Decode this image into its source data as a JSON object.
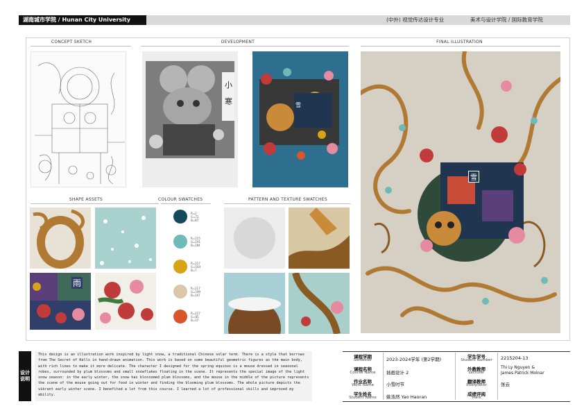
{
  "header": {
    "school": "湖南城市学院 / Hunan City University",
    "major": "(中外) 视觉传达设计专业",
    "college": "美术与设计学院 / 国际教育学院"
  },
  "sections": {
    "concept_sketch": "CONCEPT SKETCH",
    "development": "DEVELOPMENT",
    "final_illustration": "FINAL ILLUSTRATION",
    "shape_assets": "SHAPE ASSETS",
    "colour_swatches": "COLOUR SWATCHES",
    "pattern_swatches": "PATTERN AND TEXTURE SWATCHES"
  },
  "artwork": {
    "grey_glyph_1": "小",
    "grey_glyph_2": "寒",
    "blue_sign": "雪",
    "final_sign": "雪",
    "asset_glyph": "雨"
  },
  "swatches": [
    {
      "color": "#134b5d",
      "code": "R=2\nG=72\nB=87"
    },
    {
      "color": "#6fbab8",
      "code": "R=115\nG=191\nB=184"
    },
    {
      "color": "#d9a317",
      "code": "R=217\nG=164\nB=7"
    },
    {
      "color": "#d9c7a7",
      "code": "R=217\nG=199\nB=167"
    },
    {
      "color": "#d9552b",
      "code": "R=217\nG=85\nB=37"
    }
  ],
  "description": {
    "tag": "设计说明",
    "text": "This design is an illustration work inspired by light snow, a traditional Chinese solar term. There is a style that borrows from The Secret of Kells in hand-drawn animation. This work is based on some beautiful geometric figures as the main body, with rich lines to make it more delicate. The character I designed for the spring equinox is a mouse dressed in seasonal robes, surrounded by plum blossoms and small snowflakes floating in the scene. It represents the special image of the light snow season: in the early winter, the snow has blossomed plum blossoms, and the mouse in the middle of the picture represents the scene of the mouse going out for food in winter and finding the blooming plum blossoms. The whole picture depicts the vibrant early winter scene. I benefited a lot from this course. I learned a lot of professional skills and improved my ability."
  },
  "info": {
    "semester_label": "课程学期",
    "semester_sub": "Semester",
    "semester_value": "2023-2024学年 (第2学期)",
    "course_label": "课程名称",
    "course_sub": "Course Name",
    "course_value": "插画设计 2",
    "work_label": "作业名称",
    "work_sub": "Work Name",
    "work_value": "小雪时节",
    "student_label": "学生姓名",
    "student_sub": "Student Name",
    "student_value": "姚浩然 Yao Haoran",
    "number_label": "学生学号",
    "number_sub": "Student Number",
    "number_value": "2215204-13",
    "lecturer_label": "外教教师",
    "lecturer_sub": "Lecturer",
    "lecturer_value_1": "Thi Ly Nguyen &",
    "lecturer_value_2": "James Patrick Molnar",
    "interpreter_label": "翻译教师",
    "interpreter_sub": "Interpreter",
    "interpreter_value": "张云",
    "mark_label": "成绩评阅",
    "mark_sub": "Mark",
    "mark_value": ""
  }
}
